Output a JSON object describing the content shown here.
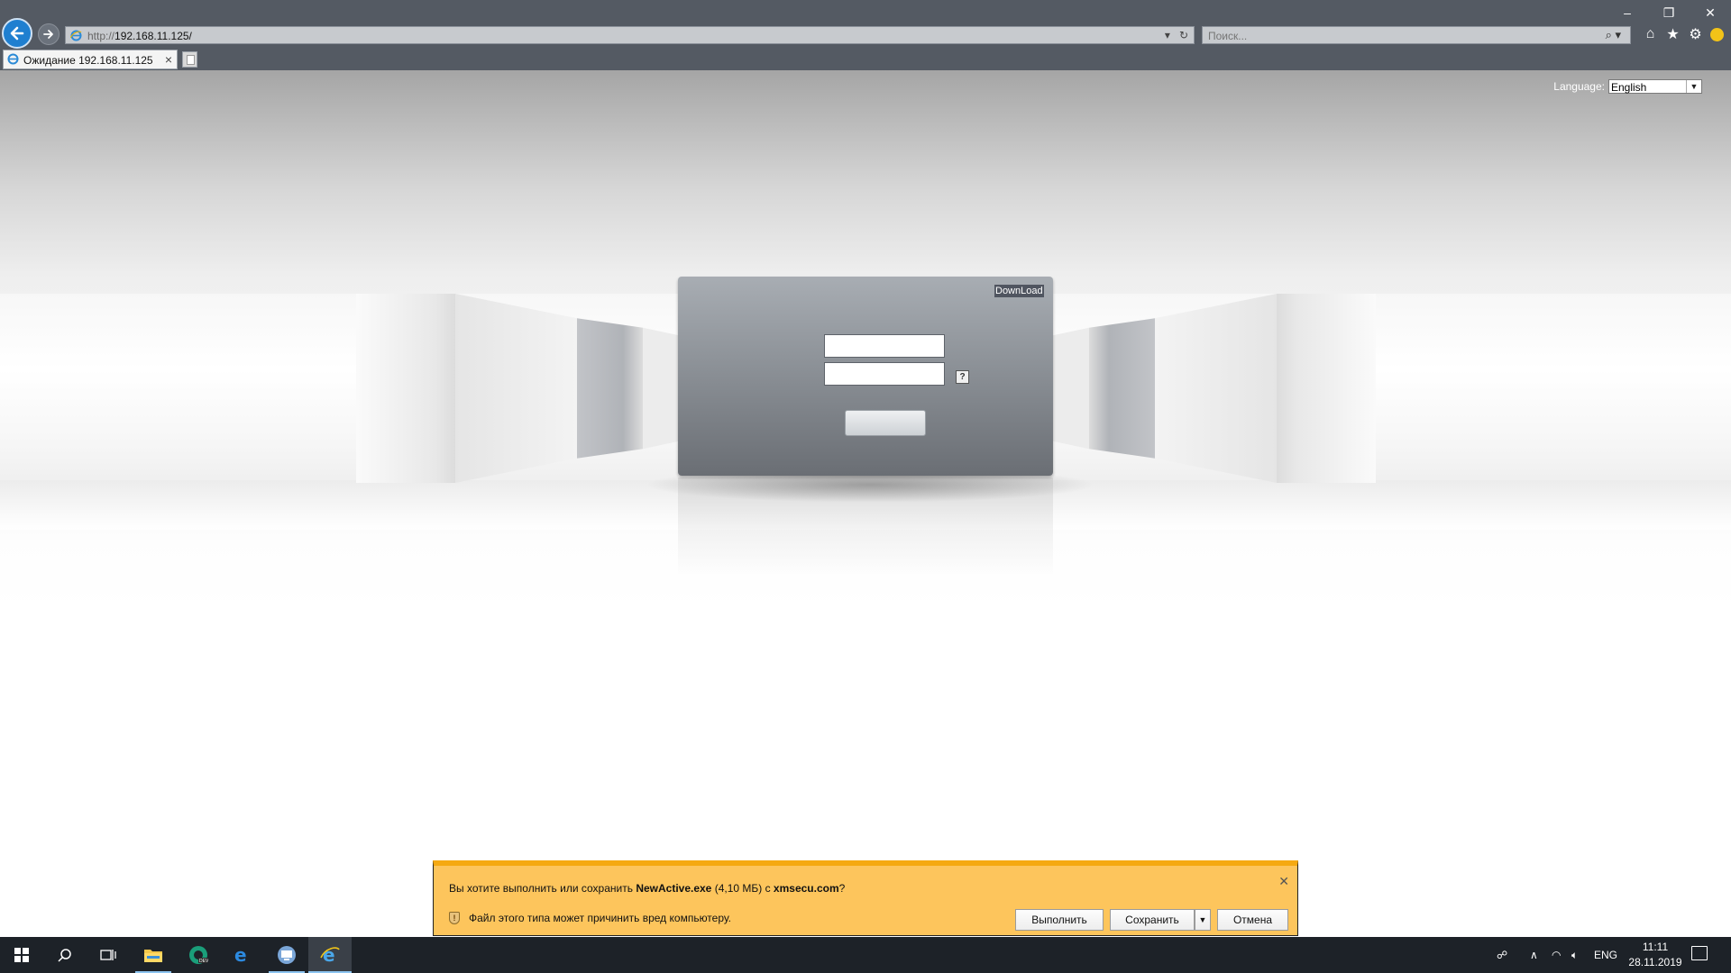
{
  "browser": {
    "url_proto": "http://",
    "url_host": "192.168.11.125/",
    "search_placeholder": "Поиск...",
    "tab_title": "Ожидание 192.168.11.125",
    "window_controls": [
      "–",
      "❐",
      "✕"
    ]
  },
  "page": {
    "language_label": "Language:",
    "language_value": "English",
    "download_button": "DownLoad",
    "help_button": "?"
  },
  "download_bar": {
    "question_prefix": "Вы хотите выполнить или сохранить ",
    "file_name": "NewActive.exe",
    "file_size": " (4,10 МБ) с ",
    "source": "xmsecu.com",
    "question_suffix": "?",
    "warning": "Файл этого типа может причинить вред компьютеру.",
    "run_button": "Выполнить",
    "save_button": "Сохранить",
    "cancel_button": "Отмена"
  },
  "taskbar": {
    "language": "ENG",
    "time": "11:11",
    "date": "28.11.2019"
  },
  "colors": {
    "accent_blue": "#1f7fd0",
    "download_bar": "#fdc55c",
    "taskbar": "#1d2228"
  }
}
